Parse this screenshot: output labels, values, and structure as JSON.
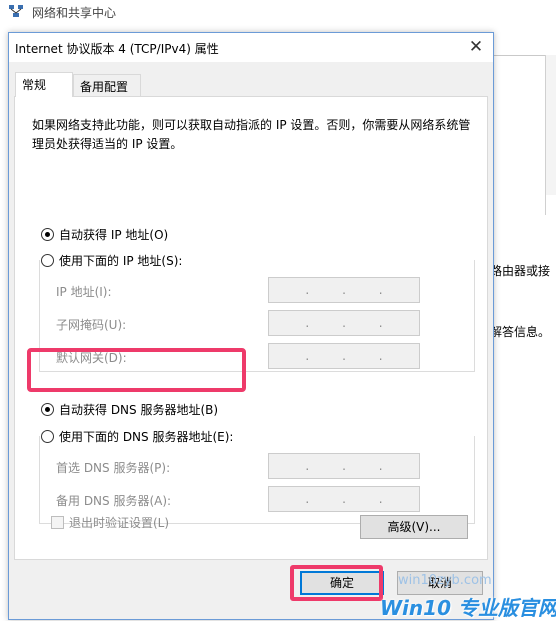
{
  "background": {
    "window_title": "网络和共享中心",
    "fragment_1": "路由器或接",
    "fragment_2": "解答信息。"
  },
  "dialog": {
    "title": "Internet 协议版本 4 (TCP/IPv4) 属性",
    "close_glyph": "✕",
    "tabs": [
      "常规",
      "备用配置"
    ],
    "description": "如果网络支持此功能，则可以获取自动指派的 IP 设置。否则，你需要从网络系统管理员处获得适当的 IP 设置。",
    "ip": {
      "auto_label": "自动获得 IP 地址(O)",
      "manual_label": "使用下面的 IP 地址(S):",
      "auto_selected": true,
      "fields": [
        {
          "label": "IP 地址(I):",
          "value": ". . ."
        },
        {
          "label": "子网掩码(U):",
          "value": ". . ."
        },
        {
          "label": "默认网关(D):",
          "value": ". . ."
        }
      ]
    },
    "dns": {
      "auto_label": "自动获得 DNS 服务器地址(B)",
      "manual_label": "使用下面的 DNS 服务器地址(E):",
      "auto_selected": true,
      "fields": [
        {
          "label": "首选 DNS 服务器(P):",
          "value": ". . ."
        },
        {
          "label": "备用 DNS 服务器(A):",
          "value": ". . ."
        }
      ]
    },
    "validate_label": "退出时验证设置(L)",
    "validate_checked": false,
    "advanced_button": "高级(V)...",
    "ok_button": "确定",
    "cancel_button": "取消"
  },
  "colors": {
    "highlight": "#ee3a6a",
    "accent": "#0078d7",
    "watermark": "#2a8fe0"
  },
  "watermark": {
    "site": "win10zyb.com",
    "brand": "Win10 专业版官网"
  }
}
